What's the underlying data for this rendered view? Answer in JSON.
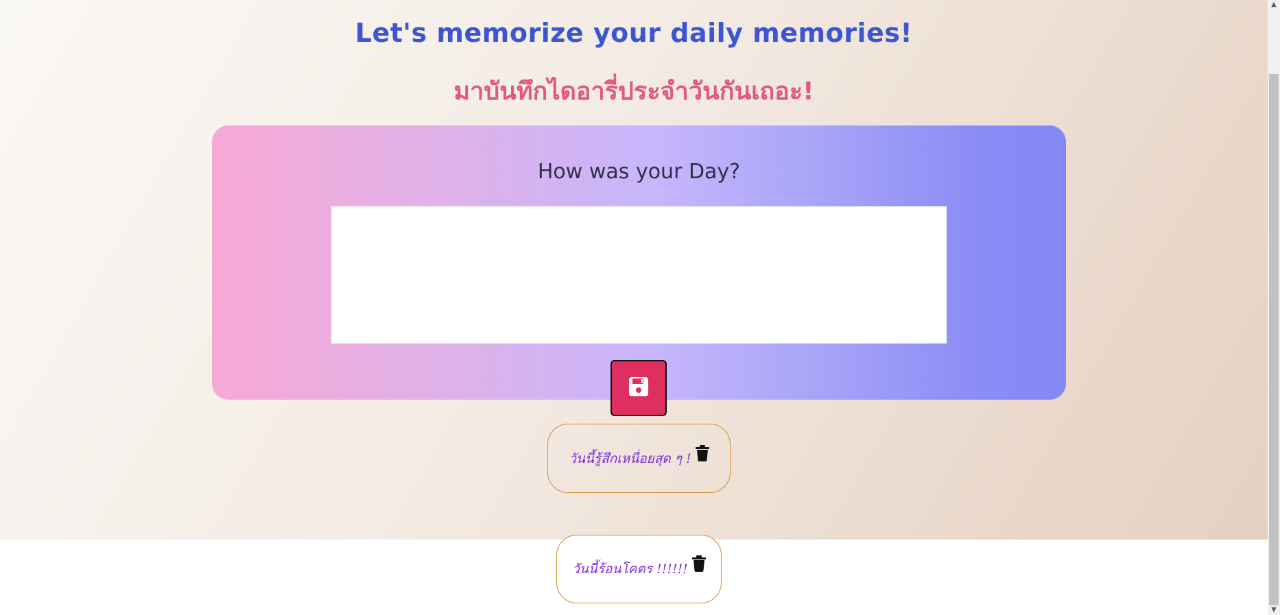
{
  "header": {
    "title_en": "Let's memorize your daily memories!",
    "title_th": "มาบันทึกไดอารี่ประจำวันกันเถอะ!"
  },
  "diary_card": {
    "heading": "How was your Day?",
    "input_value": "",
    "save_icon": "floppy-disk-icon"
  },
  "memories": [
    {
      "text": "วันนี้รู้สึกเหนื่อยสุด ๆ !",
      "icon": "trash-icon"
    },
    {
      "text": "วันนี้ร้อนโคตร !!!!!!",
      "icon": "trash-icon"
    }
  ],
  "colors": {
    "title_en": "#3d56d0",
    "title_th": "#e0577f",
    "save_button": "#df2f61",
    "memory_border": "#d98a2b",
    "memory_text": "#7b2ee0"
  },
  "scrollbar": {
    "up_arrow": "▲",
    "down_arrow": "▼"
  }
}
